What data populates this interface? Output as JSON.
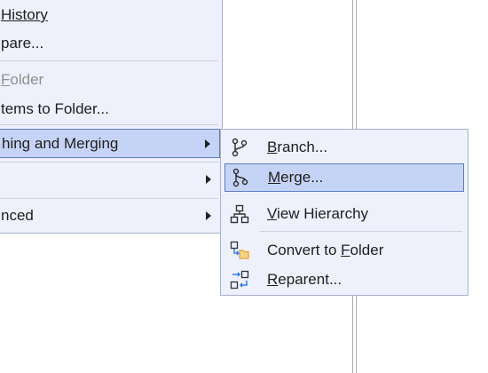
{
  "main_menu": {
    "items": [
      {
        "label": "History",
        "underline": "H",
        "state": "normal"
      },
      {
        "label": "pare...",
        "state": "normal"
      },
      {
        "label": "Folder",
        "underline": "F",
        "state": "disabled"
      },
      {
        "label": "tems to Folder...",
        "state": "normal"
      },
      {
        "label": "hing and Merging",
        "state": "highlighted",
        "has_submenu": true
      },
      {
        "label": "",
        "has_submenu": true
      },
      {
        "label": "nced",
        "has_submenu": true
      }
    ]
  },
  "submenu": {
    "items": [
      {
        "label": "Branch...",
        "underline": "B",
        "icon": "branch-icon"
      },
      {
        "label": "Merge...",
        "underline": "M",
        "icon": "merge-icon",
        "state": "highlighted"
      },
      {
        "label": "View Hierarchy",
        "underline": "V",
        "icon": "hierarchy-icon"
      },
      {
        "label": "Convert to Folder",
        "underline": "F",
        "icon": "convert-folder-icon"
      },
      {
        "label": "Reparent...",
        "underline": "R",
        "icon": "reparent-icon"
      }
    ]
  },
  "colors": {
    "menu_bg": "#eef1fb",
    "highlight_bg": "#c5d3f6",
    "highlight_border": "#5d7fc0",
    "accent_orange": "#e8a13a",
    "accent_blue": "#3a7bd5"
  }
}
